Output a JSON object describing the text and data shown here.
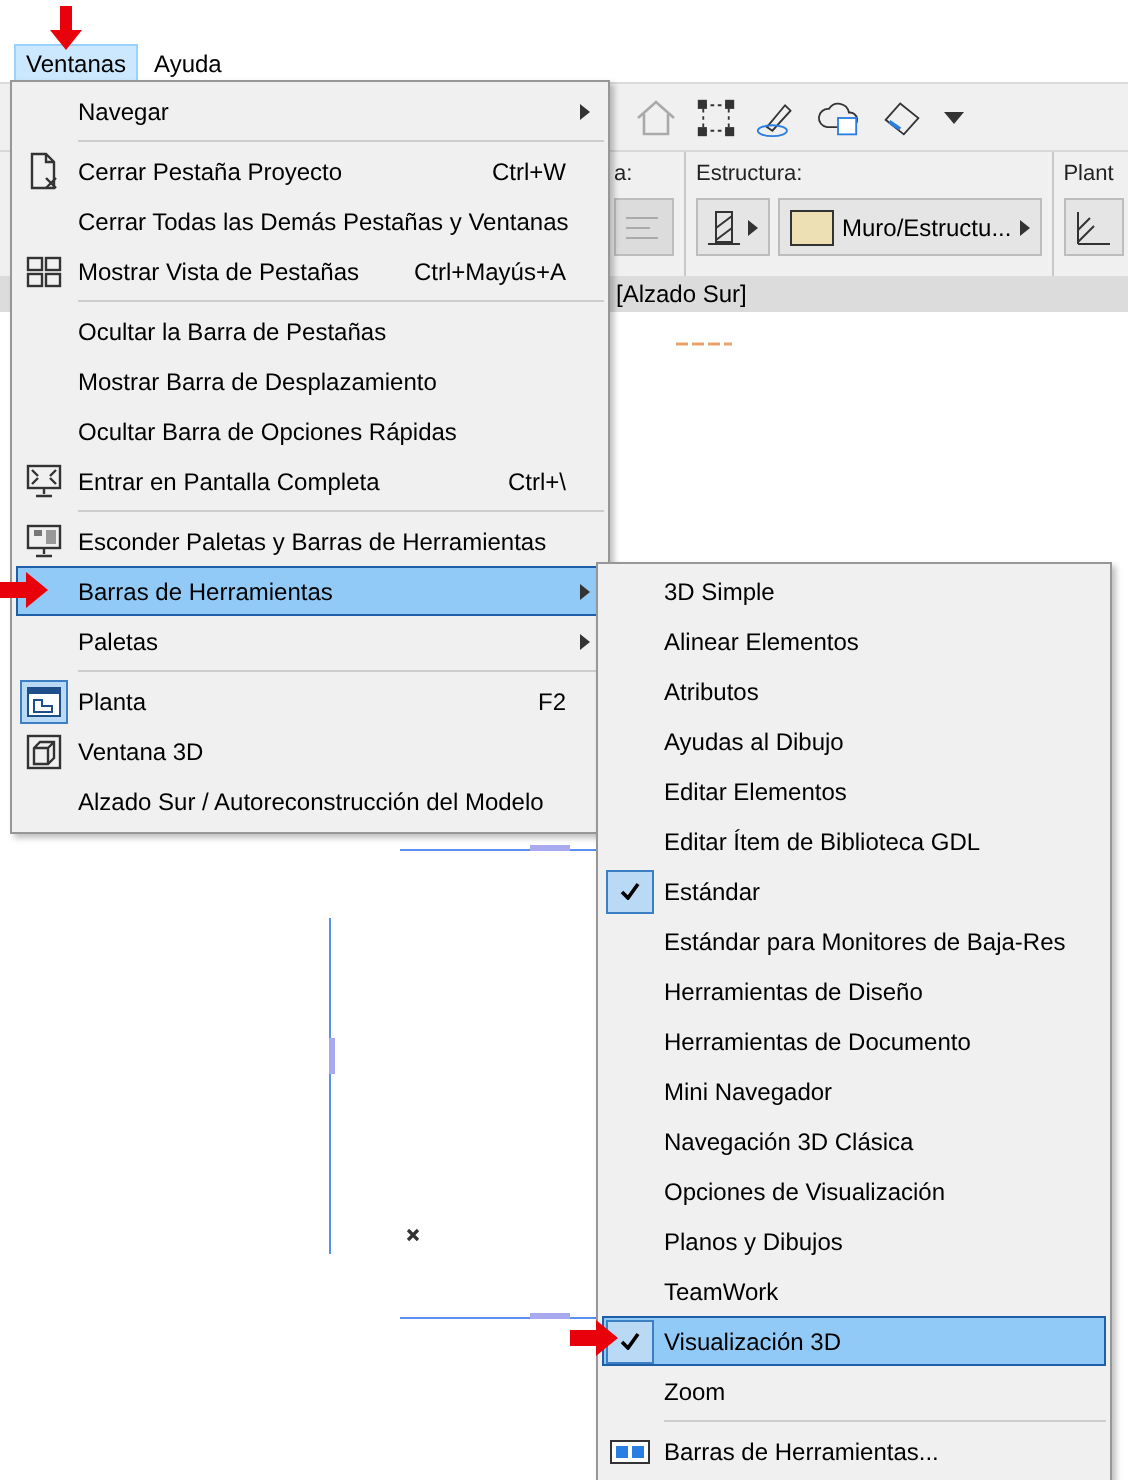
{
  "menu_bar": [
    {
      "label": "Ventanas",
      "selected": true
    },
    {
      "label": "Ayuda",
      "selected": false
    }
  ],
  "info_box": {
    "groups": [
      {
        "label": "a:"
      },
      {
        "label": "Estructura:",
        "value": "Muro/Estructu..."
      },
      {
        "label": "Plant"
      }
    ]
  },
  "tab_bar": {
    "tab": "[Alzado Sur]"
  },
  "menu": {
    "items": [
      {
        "kind": "plain",
        "label": "Navegar",
        "submenu": true,
        "selected": false,
        "checked": false
      },
      {
        "kind": "separator"
      },
      {
        "kind": "document",
        "label": "Cerrar Pestaña Proyecto",
        "shortcut": "Ctrl+W",
        "submenu": false,
        "selected": false,
        "checked": false
      },
      {
        "kind": "plain",
        "label": "Cerrar Todas las Demás Pestañas y Ventanas",
        "submenu": false,
        "selected": false,
        "checked": false
      },
      {
        "kind": "grid",
        "label": "Mostrar Vista de Pestañas",
        "shortcut": "Ctrl+Mayús+A",
        "submenu": false,
        "selected": false,
        "checked": false
      },
      {
        "kind": "separator"
      },
      {
        "kind": "plain",
        "label": "Ocultar la Barra de Pestañas",
        "submenu": false,
        "selected": false,
        "checked": false
      },
      {
        "kind": "plain",
        "label": "Mostrar Barra de Desplazamiento",
        "submenu": false,
        "selected": false,
        "checked": false
      },
      {
        "kind": "plain",
        "label": "Ocultar Barra de Opciones Rápidas",
        "submenu": false,
        "selected": false,
        "checked": false
      },
      {
        "kind": "screen",
        "label": "Entrar en Pantalla Completa",
        "shortcut": "Ctrl+\\",
        "submenu": false,
        "selected": false,
        "checked": false
      },
      {
        "kind": "separator"
      },
      {
        "kind": "monitor",
        "label": "Esconder Paletas y Barras de Herramientas",
        "submenu": false,
        "selected": false,
        "checked": false
      },
      {
        "kind": "plain",
        "label": "Barras de Herramientas",
        "submenu": true,
        "selected": true,
        "checked": false
      },
      {
        "kind": "plain",
        "label": "Paletas",
        "submenu": true,
        "selected": false,
        "checked": false
      },
      {
        "kind": "separator"
      },
      {
        "kind": "plan",
        "label": "Planta",
        "shortcut": "F2",
        "submenu": false,
        "selected": false,
        "checked": true
      },
      {
        "kind": "cube",
        "label": "Ventana 3D",
        "submenu": false,
        "selected": false,
        "checked": false
      },
      {
        "kind": "plain",
        "label": "Alzado Sur / Autoreconstrucción del Modelo",
        "submenu": false,
        "selected": false,
        "checked": false
      }
    ]
  },
  "submenu": {
    "items": [
      {
        "kind": "item",
        "label": "3D Simple",
        "checked": false,
        "selected": false
      },
      {
        "kind": "item",
        "label": "Alinear Elementos",
        "checked": false,
        "selected": false
      },
      {
        "kind": "item",
        "label": "Atributos",
        "checked": false,
        "selected": false
      },
      {
        "kind": "item",
        "label": "Ayudas al Dibujo",
        "checked": false,
        "selected": false
      },
      {
        "kind": "item",
        "label": "Editar Elementos",
        "checked": false,
        "selected": false
      },
      {
        "kind": "item",
        "label": "Editar Ítem de Biblioteca GDL",
        "checked": false,
        "selected": false
      },
      {
        "kind": "item",
        "label": "Estándar",
        "checked": true,
        "selected": false
      },
      {
        "kind": "item",
        "label": "Estándar para Monitores de Baja-Res",
        "checked": false,
        "selected": false
      },
      {
        "kind": "item",
        "label": "Herramientas de Diseño",
        "checked": false,
        "selected": false
      },
      {
        "kind": "item",
        "label": "Herramientas de Documento",
        "checked": false,
        "selected": false
      },
      {
        "kind": "item",
        "label": "Mini Navegador",
        "checked": false,
        "selected": false
      },
      {
        "kind": "item",
        "label": "Navegación 3D Clásica",
        "checked": false,
        "selected": false
      },
      {
        "kind": "item",
        "label": "Opciones de Visualización",
        "checked": false,
        "selected": false
      },
      {
        "kind": "item",
        "label": "Planos y Dibujos",
        "checked": false,
        "selected": false
      },
      {
        "kind": "item",
        "label": "TeamWork",
        "checked": false,
        "selected": false
      },
      {
        "kind": "item",
        "label": "Visualización 3D",
        "checked": true,
        "selected": true
      },
      {
        "kind": "item",
        "label": "Zoom",
        "checked": false,
        "selected": false
      },
      {
        "kind": "separator"
      },
      {
        "kind": "toolbar",
        "label": "Barras de Herramientas...",
        "checked": false,
        "selected": false
      }
    ]
  }
}
